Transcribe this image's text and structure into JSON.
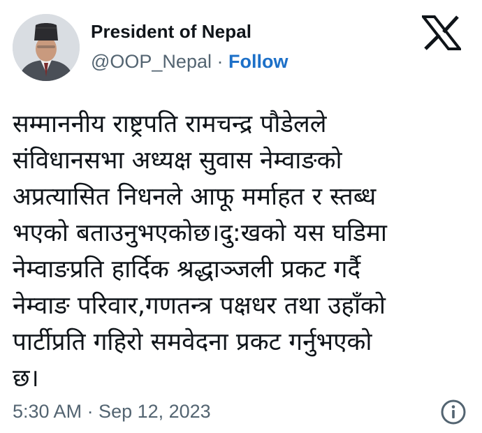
{
  "author": {
    "display_name": "President of Nepal",
    "handle": "@OOP_Nepal",
    "separator": "·",
    "follow_label": "Follow",
    "avatar_icon": "profile-photo-avatar"
  },
  "platform_icon": "x-logo-icon",
  "tweet": {
    "text": "सम्माननीय राष्ट्रपति रामचन्द्र पौडेलले\nसंविधानसभा अध्यक्ष  सुवास नेम्वाङको\nअप्रत्यासित निधनले आफू मर्माहत र स्तब्ध\nभएको बताउनुभएकोछ।दु:खको यस घडिमा\nनेम्वाङप्रति हार्दिक श्रद्धाञ्जली प्रकट गर्दै\nनेम्वाङ परिवार,गणतन्त्र पक्षधर तथा उहाँको\nपार्टीप्रति गहिरो समवेदना प्रकट गर्नुभएको\nछ।",
    "timestamp": "5:30 AM · Sep 12, 2023"
  },
  "colors": {
    "text": "#0f1419",
    "secondary": "#536471",
    "follow": "#1d70c8"
  }
}
